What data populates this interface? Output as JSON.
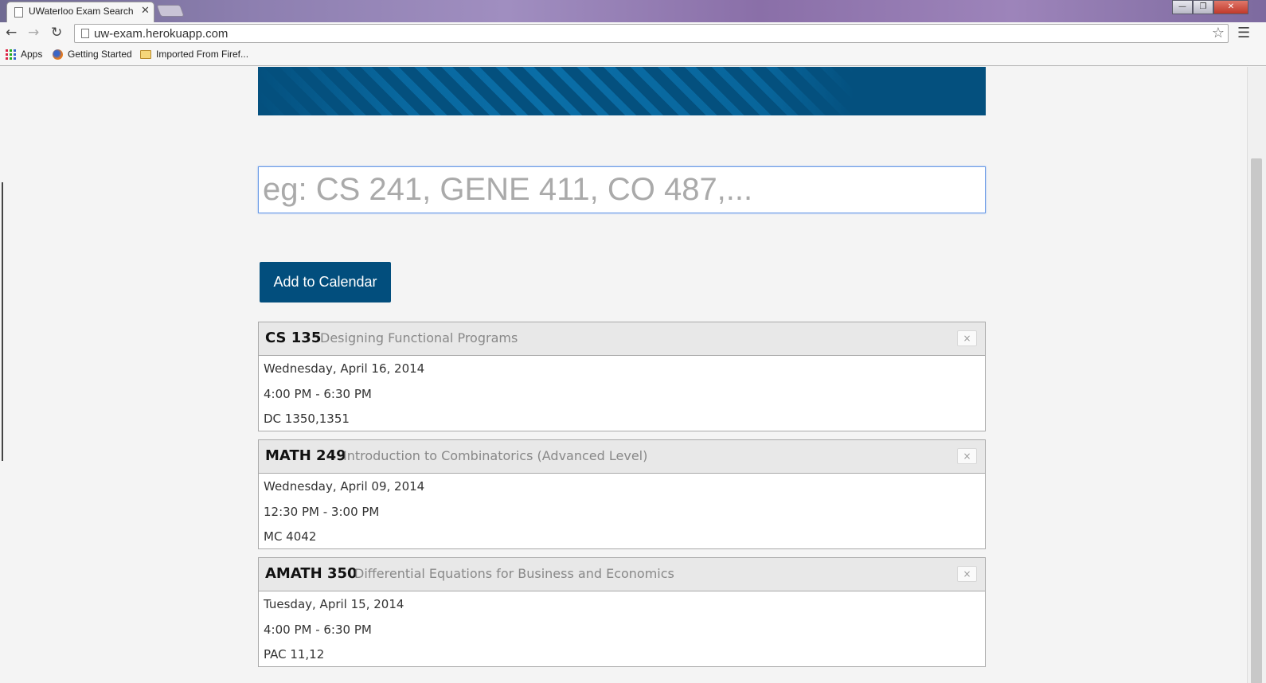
{
  "browser": {
    "tab_title": "UWaterloo Exam Search",
    "tab_close": "✕",
    "url": "uw-exam.herokuapp.com",
    "bookmarks": [
      {
        "label": "Apps"
      },
      {
        "label": "Getting Started"
      },
      {
        "label": "Imported From Firef..."
      }
    ]
  },
  "search": {
    "placeholder": "eg: CS 241, GENE 411, CO 487,..."
  },
  "add_button_label": "Add to Calendar",
  "courses": [
    {
      "code": "CS 135",
      "title": "Designing Functional Programs",
      "date": "Wednesday, April 16, 2014",
      "time": "4:00 PM - 6:30 PM",
      "location": "DC 1350,1351"
    },
    {
      "code": "MATH 249",
      "title": "Introduction to Combinatorics (Advanced Level)",
      "date": "Wednesday, April 09, 2014",
      "time": "12:30 PM - 3:00 PM",
      "location": "MC 4042"
    },
    {
      "code": "AMATH 350",
      "title": "Differential Equations for Business and Economics",
      "date": "Tuesday, April 15, 2014",
      "time": "4:00 PM - 6:30 PM",
      "location": "PAC 11,12"
    }
  ],
  "close_glyph": "×",
  "colors": {
    "banner": "#04507e",
    "button": "#024e7d",
    "card_header": "#e8e8e8"
  }
}
